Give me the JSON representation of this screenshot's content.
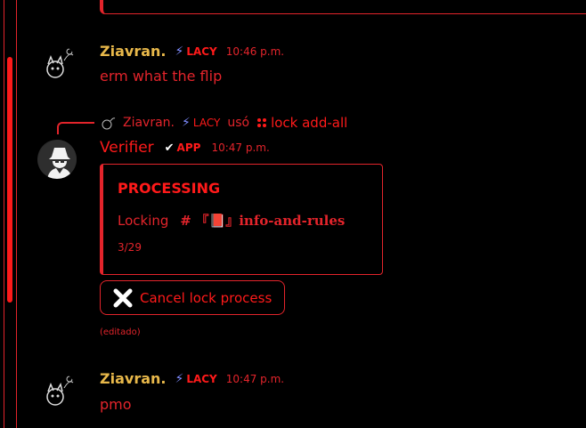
{
  "messages": [
    {
      "username": "Ziavran.",
      "tag": "LACY",
      "timestamp": "10:46 p.m.",
      "text": "erm what the flip"
    },
    {
      "reply": {
        "username": "Ziavran.",
        "tag": "LACY",
        "action": "usó",
        "command": "lock add-all"
      },
      "username": "Verifier",
      "tag": "APP",
      "timestamp": "10:47 p.m.",
      "embed": {
        "title": "PROCESSING",
        "description_prefix": "Locking",
        "channel_hash": "#",
        "channel_name": "『📕』info-and-rules",
        "footer": "3/29"
      },
      "button_label": "Cancel lock process",
      "edited": "(editado)"
    },
    {
      "username": "Ziavran.",
      "tag": "LACY",
      "timestamp": "10:47 p.m.",
      "text": "pmo"
    }
  ],
  "colors": {
    "accent": "#e3242b",
    "username": "#e8b84a",
    "bolt": "#7f8cff",
    "background": "#000000"
  }
}
